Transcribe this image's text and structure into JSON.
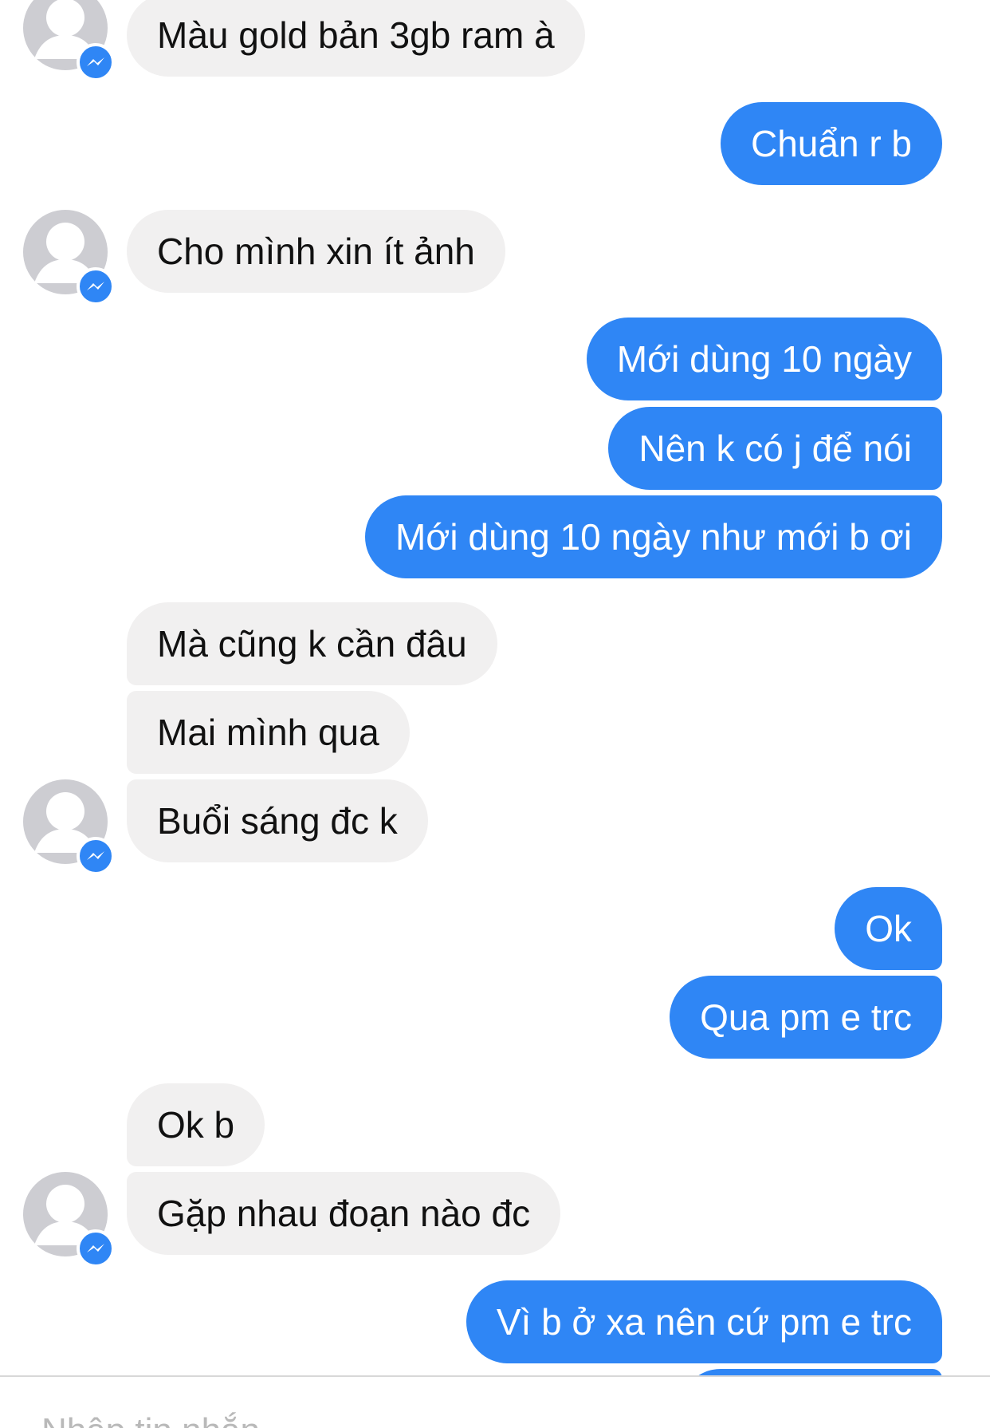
{
  "conversation": {
    "messages": [
      {
        "dir": "in",
        "text": "Màu gold bản 3gb ram à"
      },
      {
        "dir": "out",
        "text": "Chuẩn r b"
      },
      {
        "dir": "in",
        "text": "Cho mình xin ít ảnh"
      },
      {
        "dir": "out",
        "text": "Mới dùng 10 ngày"
      },
      {
        "dir": "out",
        "text": "Nên k có j để nói"
      },
      {
        "dir": "out",
        "text": "Mới dùng 10 ngày như mới b ơi"
      },
      {
        "dir": "in",
        "text": "Mà cũng k cần đâu"
      },
      {
        "dir": "in",
        "text": "Mai mình qua"
      },
      {
        "dir": "in",
        "text": "Buổi sáng đc k"
      },
      {
        "dir": "out",
        "text": "Ok"
      },
      {
        "dir": "out",
        "text": "Qua pm e trc"
      },
      {
        "dir": "in",
        "text": "Ok b"
      },
      {
        "dir": "in",
        "text": "Gặp nhau đoạn nào đc"
      },
      {
        "dir": "out",
        "text": "Vì b ở xa nên cứ pm e trc"
      }
    ]
  },
  "composer": {
    "placeholder": "Nhập tin nhắn..."
  },
  "icons": {
    "avatar": "default-profile-avatar-icon",
    "badge": "messenger-badge-icon"
  },
  "colors": {
    "outgoing_bubble": "#2f86f5",
    "incoming_bubble": "#f1f0f0",
    "incoming_text": "#111111",
    "outgoing_text": "#ffffff"
  }
}
